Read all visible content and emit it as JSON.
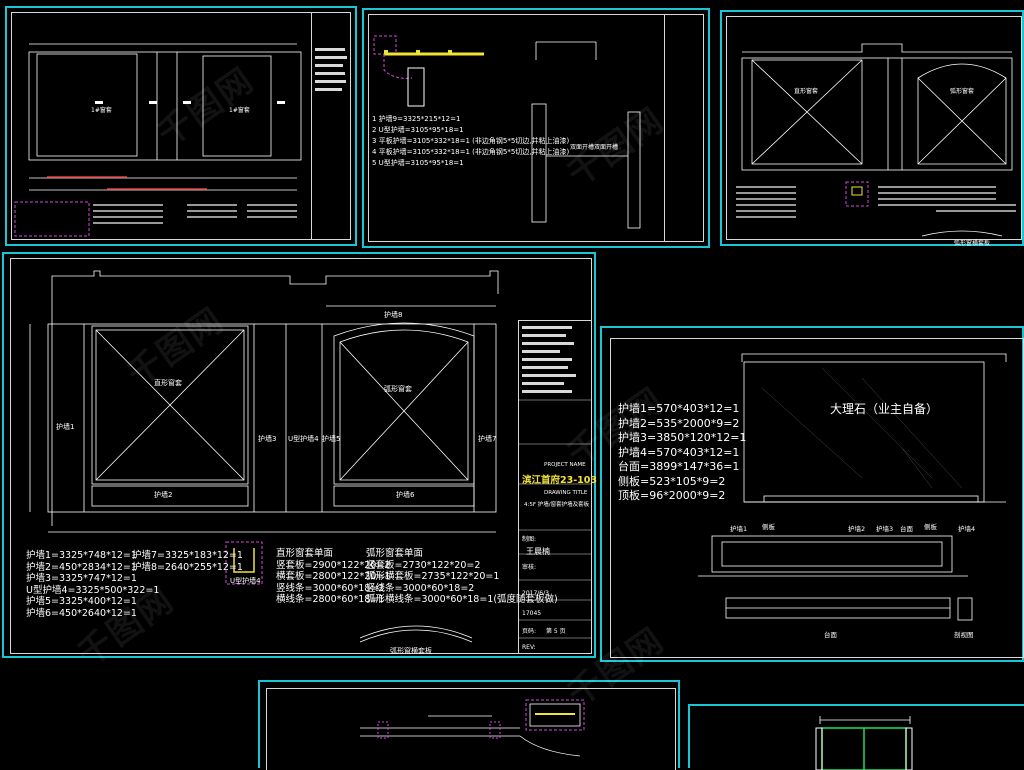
{
  "sheet_main": {
    "labels": {
      "panel_left": "直形窗套",
      "panel_right": "弧形窗套",
      "wall1": "护墙1",
      "wall2": "护墙2",
      "wall3": "护墙3",
      "wall_v": "U型护墙4",
      "wall5": "护墙5",
      "wall6": "护墙6",
      "wall7": "护墙7",
      "wall8": "护墙8",
      "u_detail": "U型护墙4",
      "arc_caption": "弧形窗横套板"
    },
    "list_left": [
      "护墙1=3325*748*12=1",
      "护墙2=450*2834*12=1",
      "护墙3=3325*747*12=1",
      "U型护墙4=3325*500*322=1",
      "护墙5=3325*400*12=1",
      "护墙6=450*2640*12=1"
    ],
    "list_mid": [
      "护墙7=3325*183*12=1",
      "护墙8=2640*255*12=1"
    ],
    "list_right_a": [
      "直形窗套单面",
      "竖套板=2900*122*20=2",
      "横套板=2800*122*20=1",
      "竖线条=3000*60*18=2",
      "横线条=2800*60*18=1"
    ],
    "list_right_b": [
      "弧形窗套单面",
      "竖套板=2730*122*20=2",
      "弧形横套板=2735*122*20=1",
      "竖线条=3000*60*18=2",
      "弧形横线条=3000*60*18=1(弧度随套板做)"
    ],
    "title_block": {
      "project_label": "PROJECT NAME",
      "project_name": "滨江首府23-103",
      "drawing_label": "DRAWING TITLE",
      "drawing_title": "4:5F 护墙/窗套护墙及套板",
      "draw_label": "制图:",
      "drawer": "王晨楠",
      "check_label": "审核:",
      "date": "2017/6/3",
      "code": "17045",
      "page_label": "页码:",
      "page": "第 5 页",
      "rev": "REV:"
    }
  },
  "sheet_marble": {
    "list": [
      "护墙1=570*403*12=1",
      "护墙2=535*2000*9=2",
      "护墙3=3850*120*12=1",
      "护墙4=570*403*12=1",
      "台面=3899*147*36=1",
      "侧板=523*105*9=2",
      "顶板=96*2000*9=2"
    ],
    "marble_label": "大理石（业主自备）",
    "sec_labels": [
      "护墙1",
      "侧板",
      "护墙2",
      "护墙3",
      "台面",
      "侧板",
      "护墙4"
    ],
    "caption_left": "台面",
    "caption_right": "剖视图"
  },
  "sheet_tr": {
    "panel_left": "直形窗套",
    "panel_right": "弧形窗套",
    "caption": "弧形窗横套板"
  },
  "sheet_tm": {
    "list": [
      "1 护墙9=3325*215*12=1",
      "2 U型护墙=3105*95*18=1",
      "3 平板护墙=3105*332*18=1 (非边角钢5*5切边,并粘上油漆)",
      "4 平板护墙=3105*332*18=1 (非边角钢5*5切边,并粘上油漆)",
      "5 U型护墙=3105*95*18=1"
    ],
    "label_a": "双面开槽",
    "label_b": "双面开槽"
  },
  "sheet_tl": {
    "labels": [
      "1#窗套",
      "1#窗套"
    ]
  },
  "watermark": "千图网"
}
